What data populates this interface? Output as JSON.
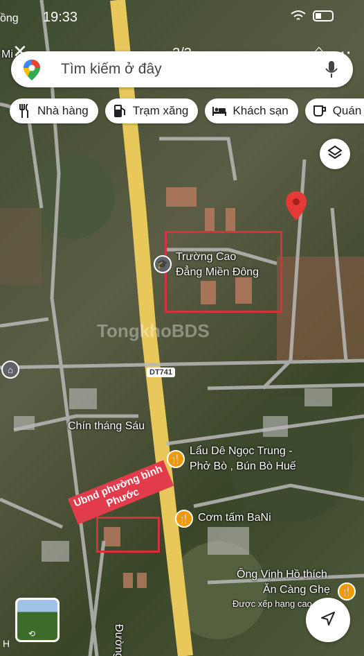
{
  "status": {
    "time": "19:33",
    "left_fragment": "ồng",
    "left_fragment2": "Mi"
  },
  "pager": "3/3",
  "search": {
    "placeholder": "Tìm kiếm ở đây"
  },
  "chips": [
    {
      "label": "Nhà hàng",
      "icon": "fork-knife-icon"
    },
    {
      "label": "Trạm xăng",
      "icon": "gas-station-icon"
    },
    {
      "label": "Khách sạn",
      "icon": "bed-icon"
    },
    {
      "label": "Quán c",
      "icon": "coffee-icon"
    }
  ],
  "labels": {
    "college": "Trường Cao\nĐẳng Miền Đông",
    "road_shield": "DT741",
    "chin_thang_sau": "Chín tháng Sáu",
    "lau_de": "Lẩu Dê Ngọc Trung -",
    "lau_de2": "Phở Bò , Bún Bò Huế",
    "com_tam": "Cơm tấm BaNi",
    "ong_vinh": "Ông Vịnh Hồ thích",
    "an_cang_ghe": "Ăn Càng Ghẹ",
    "rated": "Được xếp hạng cao",
    "duong": "Đường",
    "ubnd": "Ubnd phường bình\nPhước",
    "watermark": "TongkhoBDS",
    "bottom_fragment": "H"
  },
  "colors": {
    "pin": "#e53935",
    "annotation_red": "#d6323c",
    "poi_orange": "#f29900",
    "road_yellow": "#e8c85a"
  }
}
